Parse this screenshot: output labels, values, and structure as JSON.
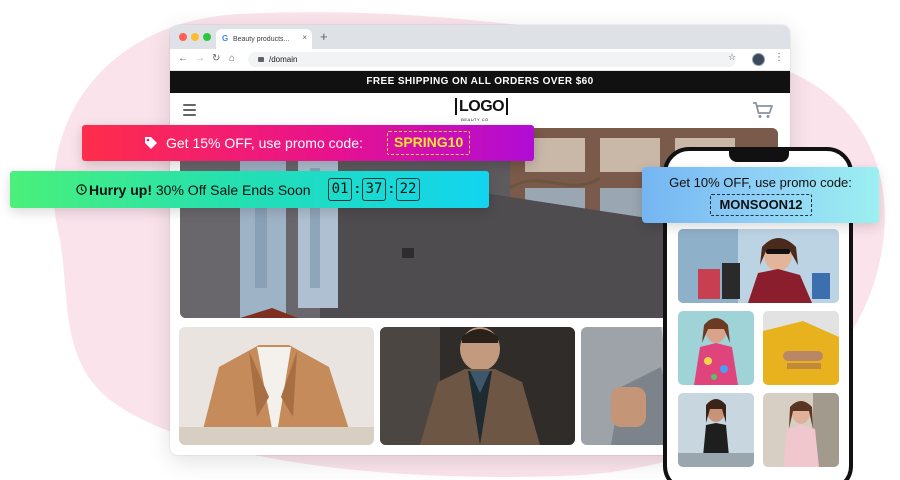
{
  "colors": {
    "blob": "#fbe3ec",
    "announcement_bg": "#111111",
    "promo1_gradient": [
      "#ff2d4a",
      "#e8128e",
      "#b10cd6"
    ],
    "promo1_code": "#ffe234",
    "promo2_gradient": [
      "#4af07a",
      "#22dfb4",
      "#12d4f0"
    ],
    "promo3_gradient": [
      "#74b5f2",
      "#8fd0f6",
      "#9bf0f0"
    ]
  },
  "browser": {
    "tab_title": "Beauty products...",
    "tab_close": "×",
    "new_tab": "+",
    "url": "/domain",
    "icons": [
      "back-arrow-icon",
      "forward-arrow-icon",
      "reload-icon",
      "home-icon",
      "lock-icon",
      "star-icon",
      "profile-avatar",
      "kebab-menu-icon"
    ]
  },
  "store": {
    "announcement": "FREE SHIPPING ON ALL ORDERS OVER $60",
    "logo_text": "LOGO",
    "logo_subtext": "BEAUTY CO",
    "icons": [
      "hamburger-menu-icon",
      "shopping-cart-icon"
    ]
  },
  "promo1": {
    "text": "Get 15% OFF, use promo code:",
    "code": "SPRING10",
    "icon": "tag-icon"
  },
  "promo2": {
    "bold_text": "Hurry up!",
    "text": " 30% Off Sale Ends Soon",
    "hours": "01",
    "minutes": "37",
    "seconds": "22",
    "separator": ":",
    "icon": "clock-icon"
  },
  "promo3": {
    "text": "Get 10% OFF, use promo code:",
    "code": "MONSOON12"
  }
}
